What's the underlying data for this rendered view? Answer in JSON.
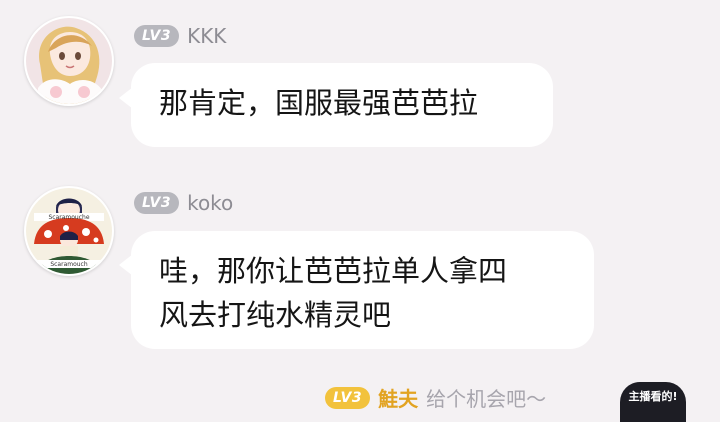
{
  "messages": [
    {
      "level_badge": "LV3",
      "username": "KKK",
      "text": "那肯定，国服最强芭芭拉",
      "avatar_icon": "anime-girl-avatar-icon"
    },
    {
      "level_badge": "LV3",
      "username": "koko",
      "text_line1": "哇，那你让芭芭拉单人拿四",
      "text_line2": "风去打纯水精灵吧",
      "avatar_icon": "mushroom-avatar-icon",
      "avatar_caption_top": "Scaramouche",
      "avatar_caption_bottom": "Scaramouch"
    }
  ],
  "bottom_message": {
    "level_badge": "LV3",
    "username": "鮭夫",
    "text": "给个机会吧～"
  },
  "corner_overlay_text": "主播看的!",
  "colors": {
    "background": "#f4f1f3",
    "bubble": "#ffffff",
    "badge": "#b7b7bd",
    "badge_gold": "#f2c23c"
  }
}
